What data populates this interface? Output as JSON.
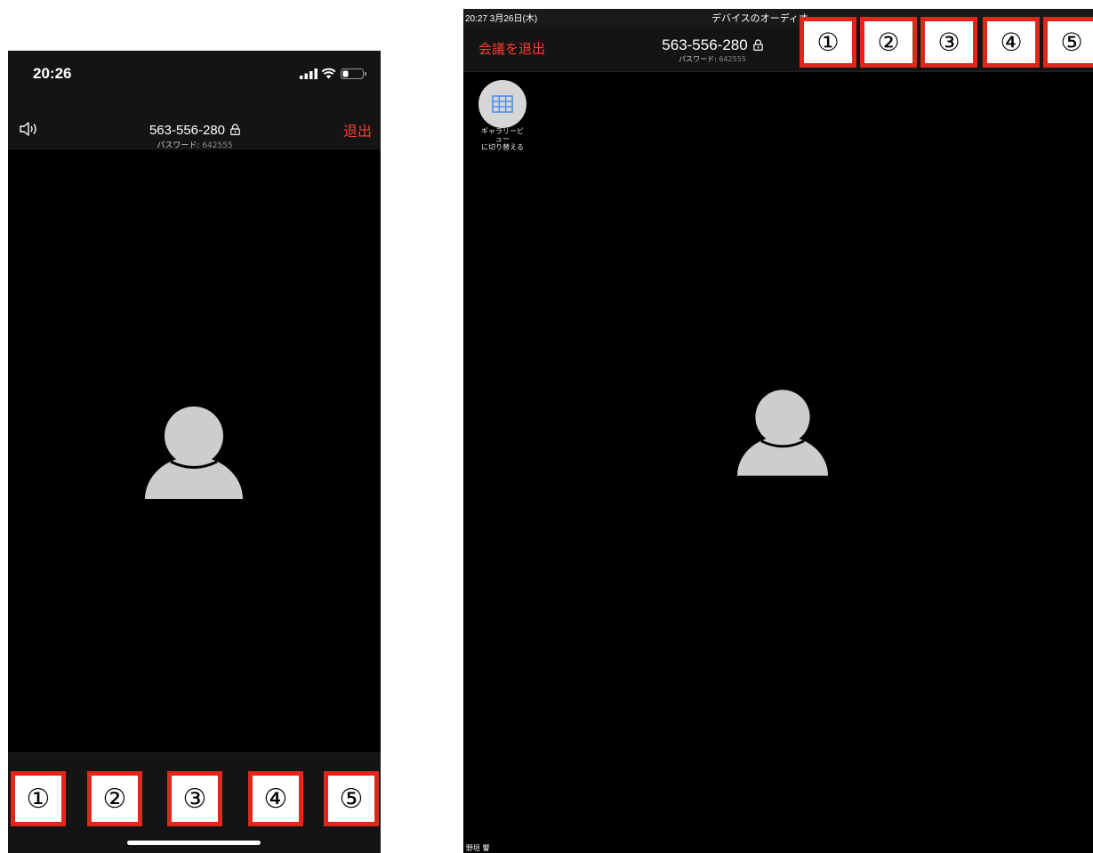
{
  "phone": {
    "status_time": "20:26",
    "meeting_id": "563-556-280",
    "password_label": "パスワード:",
    "password_value": "642555",
    "exit_label": "退出",
    "speaker_icon": "speaker-icon",
    "markers": [
      "①",
      "②",
      "③",
      "④",
      "⑤"
    ]
  },
  "tablet": {
    "status_time_date": "20:27  3月26日(木)",
    "status_center": "デバイスのオーディオ",
    "leave_label": "会議を退出",
    "meeting_id": "563-556-280",
    "password_label": "パスワード:",
    "password_value": "642555",
    "gallery_label_1": "ギャラリービ",
    "gallery_label_2": "ュー",
    "gallery_label_3": "に切り替える",
    "participant_name": "野垣 響",
    "markers": [
      "①",
      "②",
      "③",
      "④",
      "⑤"
    ]
  },
  "colors": {
    "accent_red": "#ff3b30",
    "marker_border": "#e0271c",
    "bar_background": "#141414",
    "avatar_gray": "#cdcdcd"
  }
}
